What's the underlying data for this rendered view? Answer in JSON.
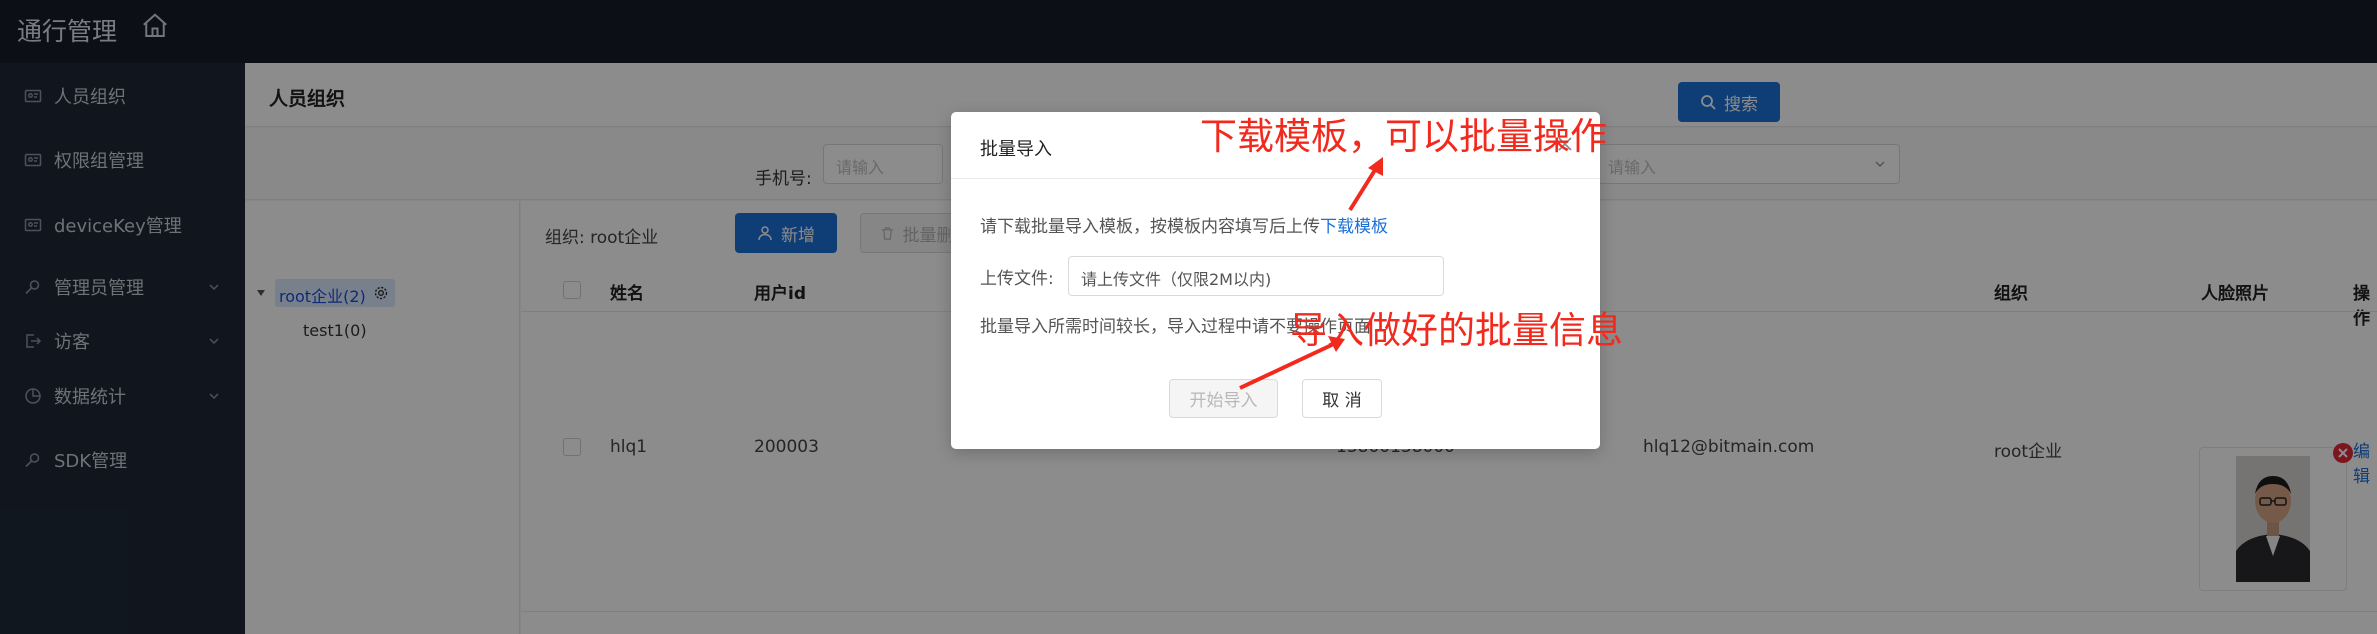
{
  "app": {
    "title": "通行管理"
  },
  "sidebar": {
    "items": [
      {
        "label": "人员组织",
        "icon": "id-card-icon"
      },
      {
        "label": "权限组管理",
        "icon": "id-card-icon"
      },
      {
        "label": "deviceKey管理",
        "icon": "id-card-icon"
      },
      {
        "label": "管理员管理",
        "icon": "key-icon"
      },
      {
        "label": "访客",
        "icon": "logout-icon"
      },
      {
        "label": "数据统计",
        "icon": "pie-chart-icon"
      },
      {
        "label": "SDK管理",
        "icon": "key-icon"
      }
    ]
  },
  "page": {
    "title": "人员组织"
  },
  "search": {
    "phone_label": "手机号:",
    "phone_placeholder": "请输入",
    "select_placeholder": "请输入",
    "button_label": "搜索"
  },
  "tree": {
    "root_label": "root企业(2)",
    "child_label": "test1(0)"
  },
  "toolbar": {
    "org_label": "组织: root企业",
    "add_label": "新增",
    "batch_delete_label": "批量删除"
  },
  "table": {
    "headers": [
      "姓名",
      "用户id",
      "组织",
      "人脸照片",
      "操作"
    ],
    "rows": [
      {
        "name": "hlq1",
        "user_id": "200003",
        "phone": "13800138000",
        "email": "hlq12@bitmain.com",
        "org": "root企业",
        "action": "编辑"
      }
    ]
  },
  "modal": {
    "title": "批量导入",
    "instruction": "请下载批量导入模板，按模板内容填写后上传",
    "download_link": "下载模板",
    "upload_label": "上传文件:",
    "upload_placeholder": "请上传文件（仅限2M以内)",
    "note": "批量导入所需时间较长，导入过程中请不要操作页面",
    "start_label": "开始导入",
    "cancel_label": "取 消"
  },
  "annotations": {
    "top": "下载模板，可以批量操作",
    "bottom": "导入做好的批量信息"
  },
  "colors": {
    "accent": "#1d6fd8",
    "annotation": "#f22a1e",
    "topbar": "#161d27",
    "sidebar": "#1f2937"
  }
}
